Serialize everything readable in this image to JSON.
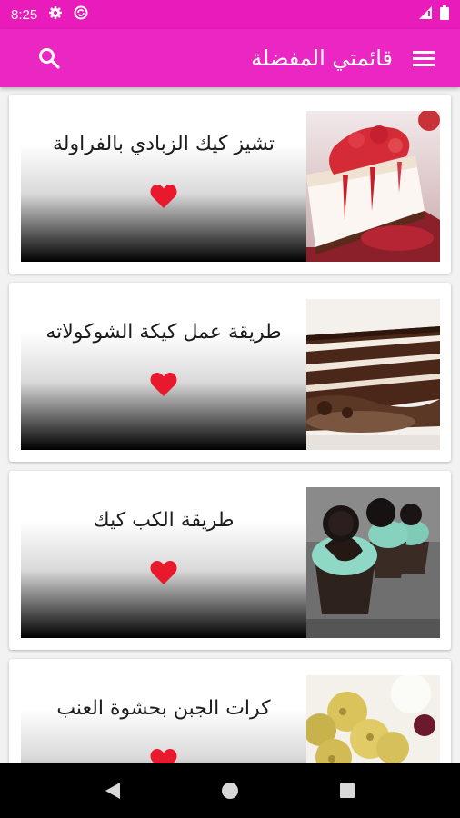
{
  "status_bar": {
    "time": "8:25",
    "icons": [
      "settings-icon",
      "sync-icon",
      "signal-icon",
      "battery-icon"
    ]
  },
  "app_bar": {
    "title": "قائمتي المفضلة",
    "left_icon": "search-icon",
    "right_icon": "menu-icon"
  },
  "favorites": [
    {
      "title": "تشيز كيك الزبادي بالفراولة",
      "image": "strawberry-cheesecake"
    },
    {
      "title": "طريقة عمل كيكة الشوكولاته",
      "image": "chocolate-layer-cake"
    },
    {
      "title": "طريقة الكب كيك",
      "image": "oreo-cupcakes"
    },
    {
      "title": "كرات الجبن بحشوة العنب",
      "image": "cheese-balls"
    }
  ],
  "nav_bar": [
    "back-icon",
    "home-icon",
    "recents-icon"
  ],
  "colors": {
    "status_bar": "#e91bbb",
    "app_bar": "#ea26c3",
    "heart": "#e8192c"
  }
}
